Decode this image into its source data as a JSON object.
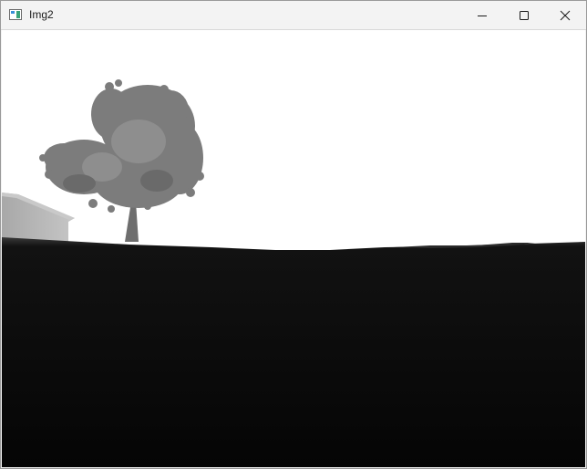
{
  "window": {
    "title": "Img2",
    "icon": "app-window-icon",
    "controls": {
      "minimize_icon": "minimize-icon",
      "maximize_icon": "maximize-icon",
      "close_icon": "close-icon"
    }
  },
  "canvas": {
    "style": "grayscale depth image",
    "sky_color": "#ffffff",
    "ground_color": "#050505",
    "tree_color": "#7a7a7a",
    "house_color": "#b4b4b4"
  }
}
